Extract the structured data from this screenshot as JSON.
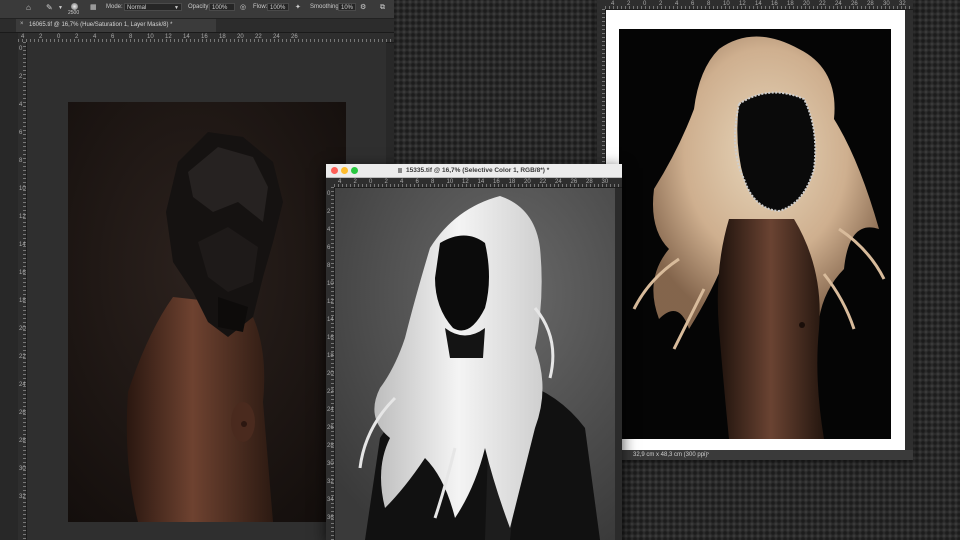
{
  "options_bar": {
    "brush_size": "2500",
    "mode_label": "Mode:",
    "mode_value": "Normal",
    "opacity_label": "Opacity:",
    "opacity_value": "100%",
    "flow_label": "Flow:",
    "flow_value": "100%",
    "smoothing_label": "Smoothing:",
    "smoothing_value": "10%"
  },
  "doc_left": {
    "tab_title": "16065.tif @ 16,7% (Hue/Saturation 1, Layer Mask/8) *",
    "ruler_h": [
      "4",
      "2",
      "0",
      "2",
      "4",
      "6",
      "8",
      "10",
      "12",
      "14",
      "16",
      "18",
      "20",
      "22",
      "24",
      "26"
    ],
    "ruler_v": [
      "0",
      "2",
      "4",
      "6",
      "8",
      "10",
      "12",
      "14",
      "16",
      "18",
      "20",
      "22",
      "24",
      "26",
      "28",
      "30",
      "32"
    ]
  },
  "doc_middle": {
    "title": "15335.tif @ 16,7% (Selective Color 1, RGB/8*) *",
    "ruler_h": [
      "4",
      "2",
      "0",
      "2",
      "4",
      "6",
      "8",
      "10",
      "12",
      "14",
      "16",
      "18",
      "20",
      "22",
      "24",
      "26",
      "28",
      "30"
    ],
    "ruler_v": [
      "0",
      "2",
      "4",
      "6",
      "8",
      "10",
      "12",
      "14",
      "16",
      "18",
      "20",
      "22",
      "24",
      "26",
      "28",
      "30",
      "32",
      "34",
      "36"
    ]
  },
  "doc_right": {
    "title": "",
    "ruler_h": [
      "4",
      "2",
      "0",
      "2",
      "4",
      "6",
      "8",
      "10",
      "12",
      "14",
      "16",
      "18",
      "20",
      "22",
      "24",
      "26",
      "28",
      "30",
      "32"
    ],
    "status": "32,9 cm x 48,3 cm (300 ppi)"
  },
  "colors": {
    "panel_bg": "#323232",
    "titlebar": "#ececec",
    "close": "#fe5f57",
    "minimize": "#febc2e",
    "zoom": "#28c840"
  }
}
